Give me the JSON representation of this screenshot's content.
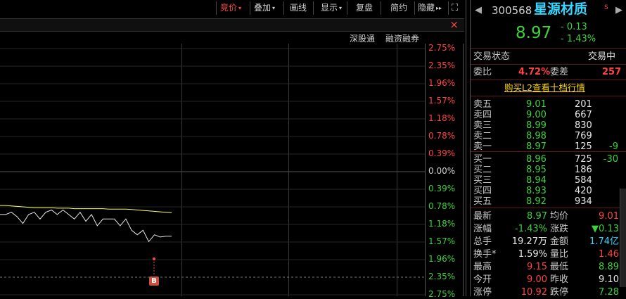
{
  "toolbar": {
    "buttons": [
      {
        "label": "竞价",
        "caret": "▾",
        "active": true
      },
      {
        "label": "叠加",
        "caret": "▾"
      },
      {
        "label": "画线"
      },
      {
        "label": "显示",
        "caret": "▾"
      },
      {
        "label": "复盘"
      },
      {
        "label": "简约"
      },
      {
        "label": "隐藏",
        "caret": "▸▸"
      }
    ],
    "close": "×",
    "fullscreen": "⛶"
  },
  "chart_header": {
    "right_labels": [
      "深股通",
      "融资融券"
    ]
  },
  "chart_data": {
    "type": "line",
    "ylabels_right": [
      "2.75%",
      "2.35%",
      "1.96%",
      "1.57%",
      "1.18%",
      "0.78%",
      "0.39%",
      "0.00%",
      "0.39%",
      "0.78%",
      "1.18%",
      "1.57%",
      "1.96%",
      "2.35%",
      "2.75%"
    ],
    "marker": "B",
    "series": [
      {
        "color": "#e8e8e8",
        "values": [
          -0.95,
          -0.95,
          -0.9,
          -1.0,
          -1.15,
          -0.95,
          -0.9,
          -1.05,
          -0.9,
          -0.85,
          -0.95,
          -0.85,
          -0.95,
          -1.05,
          -0.9,
          -1.1,
          -0.95,
          -1.2,
          -1.05,
          -1.05,
          -1.05,
          -1.2,
          -1.05,
          -1.3,
          -1.4,
          -1.3,
          -1.55,
          -1.4,
          -1.45,
          -1.43,
          -1.43
        ]
      },
      {
        "color": "#ffff66",
        "values": [
          -0.75,
          -0.75,
          -0.76,
          -0.77,
          -0.78,
          -0.79,
          -0.8,
          -0.8,
          -0.8,
          -0.8,
          -0.81,
          -0.81,
          -0.81,
          -0.82,
          -0.82,
          -0.82,
          -0.82,
          -0.82,
          -0.82,
          -0.83,
          -0.83,
          -0.83,
          -0.83,
          -0.84,
          -0.85,
          -0.86,
          -0.87,
          -0.88,
          -0.89,
          -0.9,
          -0.91
        ]
      }
    ]
  },
  "quote": {
    "code": "300568",
    "name": "星源材质",
    "price": "8.97",
    "change": "- 0.13",
    "change_pct": "- 1.43%",
    "status_label": "交易状态",
    "status_value": "交易中",
    "wb_label": "委比",
    "wb_value": "4.72%",
    "wc_label": "委差",
    "wc_value": "257",
    "l2_link": "购买L2查看十档行情",
    "asks": [
      {
        "label": "卖五",
        "price": "9.01",
        "vol": "201",
        "chg": ""
      },
      {
        "label": "卖四",
        "price": "9.00",
        "vol": "667",
        "chg": ""
      },
      {
        "label": "卖三",
        "price": "8.99",
        "vol": "830",
        "chg": ""
      },
      {
        "label": "卖二",
        "price": "8.98",
        "vol": "769",
        "chg": ""
      },
      {
        "label": "卖一",
        "price": "8.97",
        "vol": "125",
        "chg": "-9"
      }
    ],
    "bids": [
      {
        "label": "买一",
        "price": "8.96",
        "vol": "725",
        "chg": "-30"
      },
      {
        "label": "买二",
        "price": "8.95",
        "vol": "186",
        "chg": ""
      },
      {
        "label": "买三",
        "price": "8.94",
        "vol": "584",
        "chg": ""
      },
      {
        "label": "买四",
        "price": "8.93",
        "vol": "420",
        "chg": ""
      },
      {
        "label": "买五",
        "price": "8.92",
        "vol": "934",
        "chg": ""
      }
    ],
    "stats": [
      {
        "l1": "最新",
        "v1": "8.97",
        "c1": "green",
        "l2": "均价",
        "v2": "9.01",
        "c2": "red"
      },
      {
        "l1": "涨幅",
        "v1": "-1.43%",
        "c1": "green",
        "l2": "涨跌",
        "v2": "▼0.13",
        "c2": "green"
      },
      {
        "l1": "总手",
        "v1": "19.27万",
        "c1": "white",
        "l2": "金额",
        "v2": "1.74亿",
        "c2": "cyan"
      },
      {
        "l1": "换手*",
        "v1": "1.59%",
        "c1": "white",
        "l2": "量比",
        "v2": "1.46",
        "c2": "red"
      },
      {
        "l1": "最高",
        "v1": "9.15",
        "c1": "red",
        "l2": "最低",
        "v2": "8.89",
        "c2": "green"
      },
      {
        "l1": "今开",
        "v1": "9.00",
        "c1": "red",
        "l2": "昨收",
        "v2": "9.10",
        "c2": "white"
      },
      {
        "l1": "涨停",
        "v1": "10.92",
        "c1": "red",
        "l2": "跌停",
        "v2": "7.28",
        "c2": "green"
      }
    ]
  }
}
